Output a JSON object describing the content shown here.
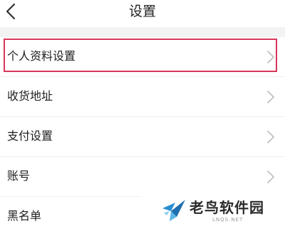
{
  "header": {
    "title": "设置",
    "back_icon": "chevron-left-icon"
  },
  "menu": {
    "items": [
      {
        "label": "个人资料设置",
        "highlighted": true
      },
      {
        "label": "收货地址"
      },
      {
        "label": "支付设置"
      },
      {
        "label": "账号"
      },
      {
        "label": "黑名单"
      }
    ],
    "chevron_icon": "chevron-right-icon"
  },
  "watermark": {
    "text": "老鸟软件园",
    "subtext": "LNQS.NET"
  },
  "colors": {
    "highlight_border": "#d8375a",
    "background_gap": "#f3f3f3",
    "chevron": "#bdbdbd",
    "logo_blue": "#2a8fd0"
  }
}
